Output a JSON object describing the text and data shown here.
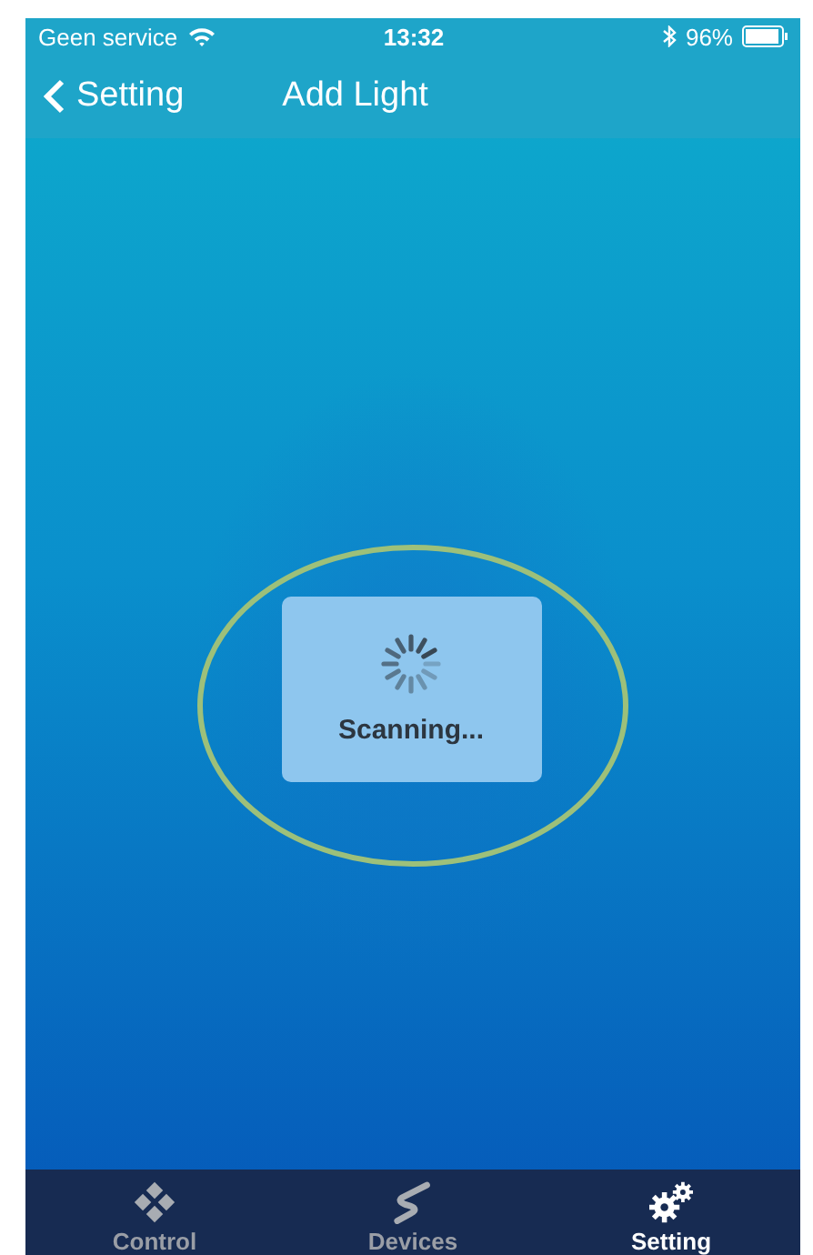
{
  "status_bar": {
    "carrier": "Geen service",
    "time": "13:32",
    "battery": "96%"
  },
  "nav": {
    "back": "Setting",
    "title": "Add Light"
  },
  "loading": {
    "text": "Scanning..."
  },
  "tabs": [
    {
      "label": "Control",
      "kind": "control",
      "selected": false
    },
    {
      "label": "Devices",
      "kind": "devices",
      "selected": false
    },
    {
      "label": "Setting",
      "kind": "setting",
      "selected": true
    }
  ]
}
